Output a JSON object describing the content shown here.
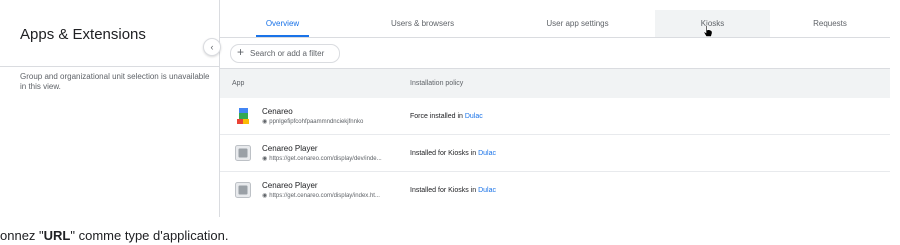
{
  "sidebar": {
    "title": "Apps & Extensions",
    "note": "Group and organizational unit selection is unavailable in this view."
  },
  "tabs": [
    {
      "label": "Overview",
      "active": true
    },
    {
      "label": "Users & browsers",
      "active": false
    },
    {
      "label": "User app settings",
      "active": false
    },
    {
      "label": "Kiosks",
      "active": false
    },
    {
      "label": "Requests",
      "active": false
    }
  ],
  "filter": {
    "placeholder": "Search or add a filter"
  },
  "table": {
    "headers": {
      "app": "App",
      "policy": "Installation policy"
    },
    "rows": [
      {
        "name": "Cenareo",
        "sub": "ppnlgefipfcohfpaammndnciekjfnnko",
        "policy_prefix": "Force installed in",
        "ou": "Dulac",
        "icon": "cenareo-app-icon"
      },
      {
        "name": "Cenareo Player",
        "sub": "https://get.cenareo.com/display/dev/inde...",
        "policy_prefix": "Installed for Kiosks in",
        "ou": "Dulac",
        "icon": "web-app-icon"
      },
      {
        "name": "Cenareo Player",
        "sub": "https://get.cenareo.com/display/index.ht...",
        "policy_prefix": "Installed for Kiosks in",
        "ou": "Dulac",
        "icon": "web-app-icon"
      }
    ]
  },
  "bottom_text": {
    "prefix": "onnez \"",
    "bold": "URL",
    "suffix": "\" comme type d'application."
  },
  "colors": {
    "accent": "#1a73e8",
    "border": "#dadce0",
    "header_bg": "#f1f3f4"
  }
}
